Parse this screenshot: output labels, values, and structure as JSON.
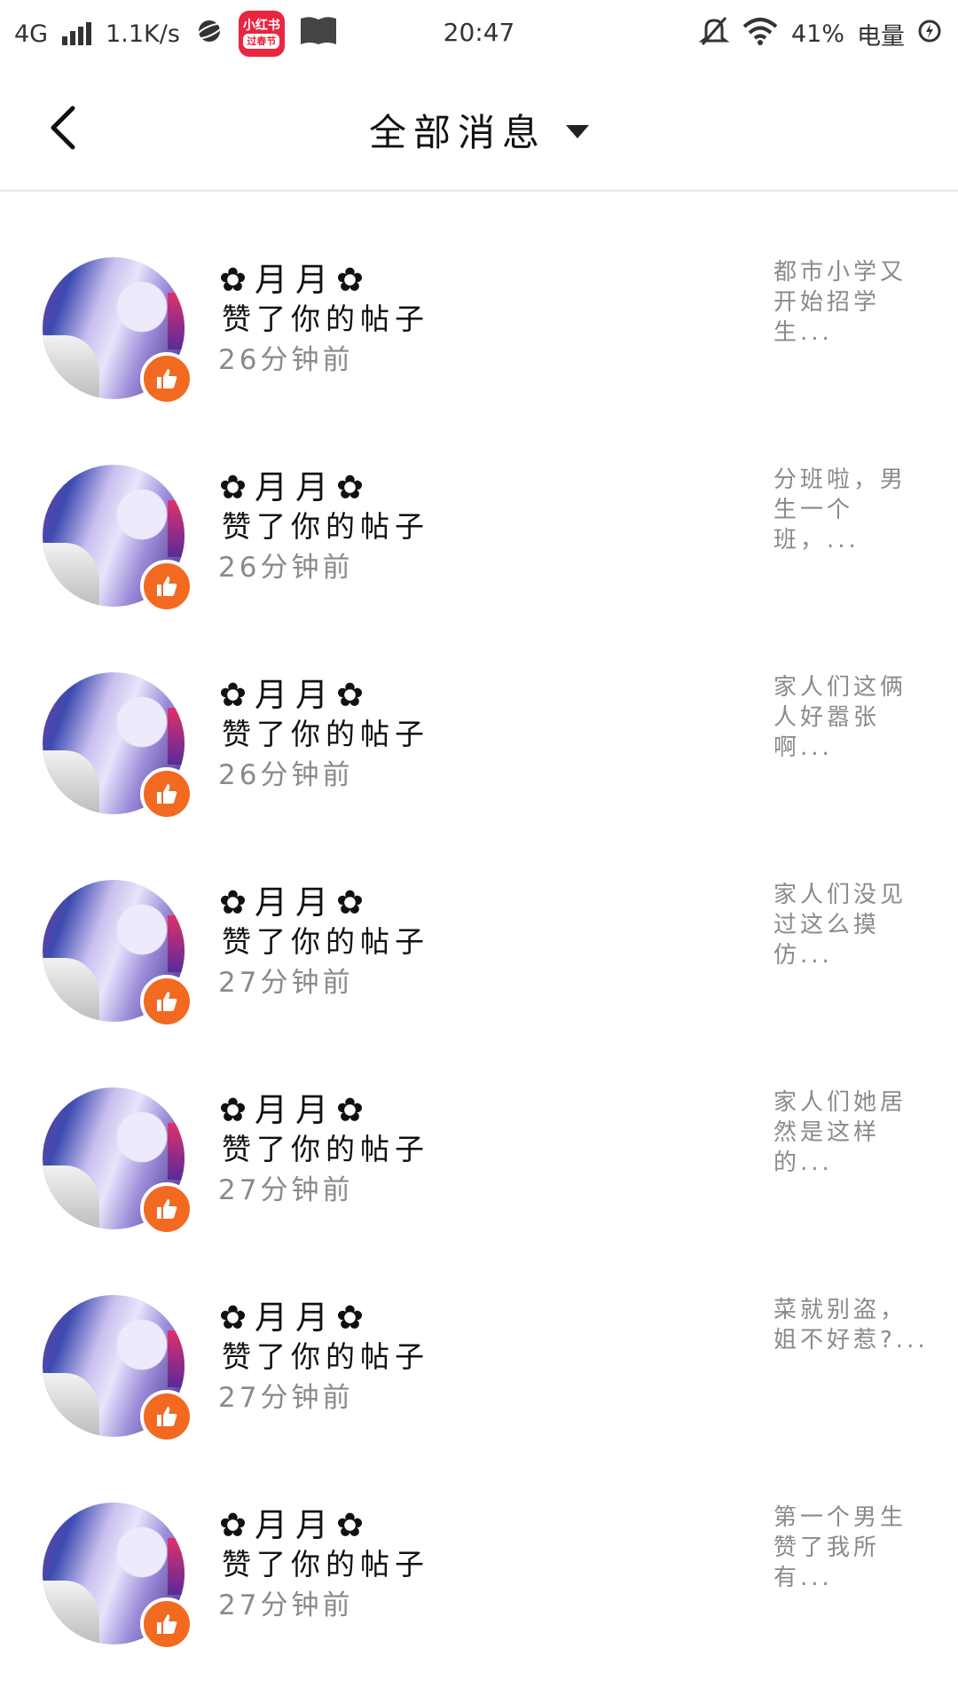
{
  "status_bar": {
    "network": "4G",
    "speed": "1.1K/s",
    "app_badge_top": "小红书",
    "app_badge_bottom": "过春节",
    "time": "20:47",
    "battery_percent": "41%",
    "battery_label": "电量"
  },
  "header": {
    "title": "全部消息",
    "back_icon": "chevron-left-icon",
    "dropdown_icon": "triangle-down-icon"
  },
  "colors": {
    "like_badge": "#f26a21",
    "secondary_text": "#8a8a8a"
  },
  "notifications": [
    {
      "user_name": "✿月月✿",
      "action": "赞了你的帖子",
      "time": "26分钟前",
      "post_snippet": "都市小学又开始招学生..."
    },
    {
      "user_name": "✿月月✿",
      "action": "赞了你的帖子",
      "time": "26分钟前",
      "post_snippet": "分班啦，男生一个班，..."
    },
    {
      "user_name": "✿月月✿",
      "action": "赞了你的帖子",
      "time": "26分钟前",
      "post_snippet": "家人们这俩人好嚣张啊..."
    },
    {
      "user_name": "✿月月✿",
      "action": "赞了你的帖子",
      "time": "27分钟前",
      "post_snippet": "家人们没见过这么摸仿..."
    },
    {
      "user_name": "✿月月✿",
      "action": "赞了你的帖子",
      "time": "27分钟前",
      "post_snippet": "家人们她居然是这样的..."
    },
    {
      "user_name": "✿月月✿",
      "action": "赞了你的帖子",
      "time": "27分钟前",
      "post_snippet": "菜就别盗，姐不好惹?..."
    },
    {
      "user_name": "✿月月✿",
      "action": "赞了你的帖子",
      "time": "27分钟前",
      "post_snippet": "第一个男生赞了我所有..."
    }
  ]
}
